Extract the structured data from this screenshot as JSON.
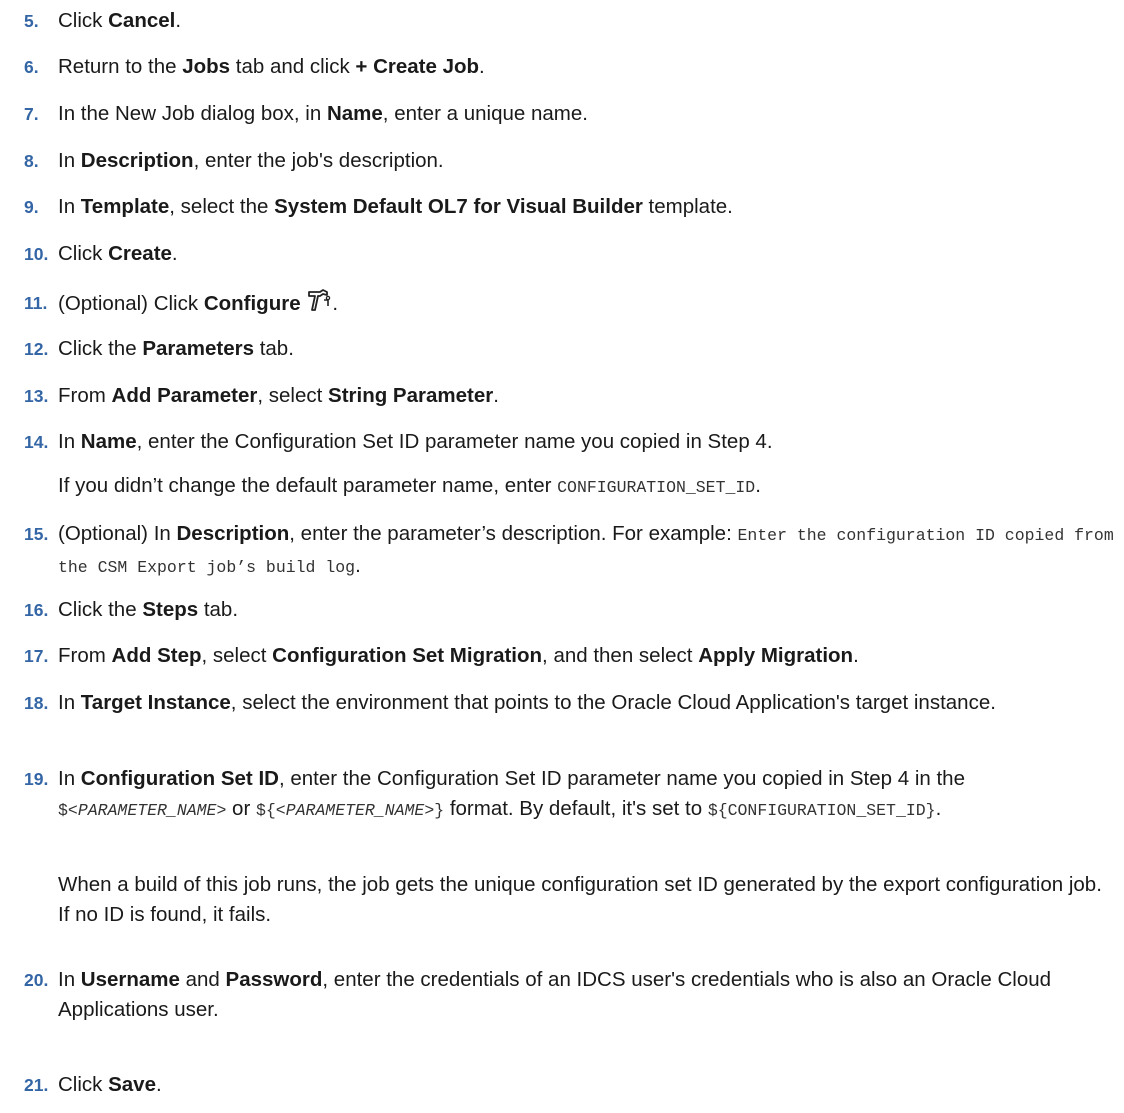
{
  "steps": [
    {
      "num": "5.",
      "parts": [
        {
          "t": "Click "
        },
        {
          "b": "Cancel"
        },
        {
          "t": "."
        }
      ]
    },
    {
      "num": "6.",
      "parts": [
        {
          "t": "Return to the "
        },
        {
          "b": "Jobs"
        },
        {
          "t": " tab and click "
        },
        {
          "b": "+ Create Job"
        },
        {
          "t": "."
        }
      ]
    },
    {
      "num": "7.",
      "parts": [
        {
          "t": "In the New Job dialog box, in "
        },
        {
          "b": "Name"
        },
        {
          "t": ", enter a unique name."
        }
      ]
    },
    {
      "num": "8.",
      "parts": [
        {
          "t": "In "
        },
        {
          "b": "Description"
        },
        {
          "t": ", enter the job's description."
        }
      ]
    },
    {
      "num": "9.",
      "parts": [
        {
          "t": "In "
        },
        {
          "b": "Template"
        },
        {
          "t": ", select the "
        },
        {
          "b": "System Default OL7 for Visual Builder"
        },
        {
          "t": " template."
        }
      ]
    },
    {
      "num": "10.",
      "parts": [
        {
          "t": "Click "
        },
        {
          "b": "Create"
        },
        {
          "t": "."
        }
      ]
    },
    {
      "num": "11.",
      "parts": [
        {
          "t": "(Optional) Click "
        },
        {
          "b": "Configure"
        },
        {
          "t": " "
        },
        {
          "icon": "configure-hammer-icon"
        },
        {
          "t": "."
        }
      ]
    },
    {
      "num": "12.",
      "parts": [
        {
          "t": "Click the "
        },
        {
          "b": "Parameters"
        },
        {
          "t": " tab."
        }
      ]
    },
    {
      "num": "13.",
      "parts": [
        {
          "t": "From "
        },
        {
          "b": "Add Parameter"
        },
        {
          "t": ", select "
        },
        {
          "b": "String Parameter"
        },
        {
          "t": "."
        }
      ]
    },
    {
      "num": "14.",
      "parts": [
        {
          "t": "In "
        },
        {
          "b": "Name"
        },
        {
          "t": ", enter the Configuration Set ID parameter name you copied in Step 4."
        }
      ]
    },
    {
      "num": "15.",
      "parts": [
        {
          "t": "(Optional) In "
        },
        {
          "b": "Description"
        },
        {
          "t": ", enter the parameter’s description. For example: "
        },
        {
          "m": "Enter the configuration ID copied from the CSM Export job’s build log"
        },
        {
          "t": "."
        }
      ]
    },
    {
      "num": "16.",
      "parts": [
        {
          "t": "Click the "
        },
        {
          "b": "Steps"
        },
        {
          "t": " tab."
        }
      ]
    },
    {
      "num": "17.",
      "parts": [
        {
          "t": "From "
        },
        {
          "b": "Add Step"
        },
        {
          "t": ", select "
        },
        {
          "b": "Configuration Set Migration"
        },
        {
          "t": ", and then select "
        },
        {
          "b": "Apply Migration"
        },
        {
          "t": "."
        }
      ]
    },
    {
      "num": "18.",
      "parts": [
        {
          "t": "In "
        },
        {
          "b": "Target Instance"
        },
        {
          "t": ", select the environment that points to the Oracle Cloud Application's target instance."
        }
      ]
    },
    {
      "num": "19.",
      "parts": [
        {
          "t": "In "
        },
        {
          "b": "Configuration Set ID"
        },
        {
          "t": ", enter the Configuration Set ID parameter name you copied in Step 4 in the "
        },
        {
          "m": "$<"
        },
        {
          "mi": "PARAMETER_NAME"
        },
        {
          "m": ">"
        },
        {
          "t": " or "
        },
        {
          "m": "${<"
        },
        {
          "mi": "PARAMETER_NAME"
        },
        {
          "m": ">}"
        },
        {
          "t": " format. By default, it's set to "
        },
        {
          "m": "${CONFIGURATION_SET_ID}"
        },
        {
          "t": "."
        }
      ]
    },
    {
      "num": "20.",
      "parts": [
        {
          "t": "In "
        },
        {
          "b": "Username"
        },
        {
          "t": " and "
        },
        {
          "b": "Password"
        },
        {
          "t": ", enter the credentials of an IDCS user's credentials who is also an Oracle Cloud Applications user."
        }
      ]
    },
    {
      "num": "21.",
      "parts": [
        {
          "t": "Click "
        },
        {
          "b": "Save"
        },
        {
          "t": "."
        }
      ]
    }
  ],
  "notes": {
    "step14": [
      {
        "t": "If you didn’t change the default parameter name, enter "
      },
      {
        "m": "CONFIGURATION_SET_ID"
      },
      {
        "t": "."
      }
    ],
    "step19": [
      {
        "t": "When a build of this job runs, the job gets the unique configuration set ID generated by the export configuration job. If no ID is found, it fails."
      }
    ]
  }
}
